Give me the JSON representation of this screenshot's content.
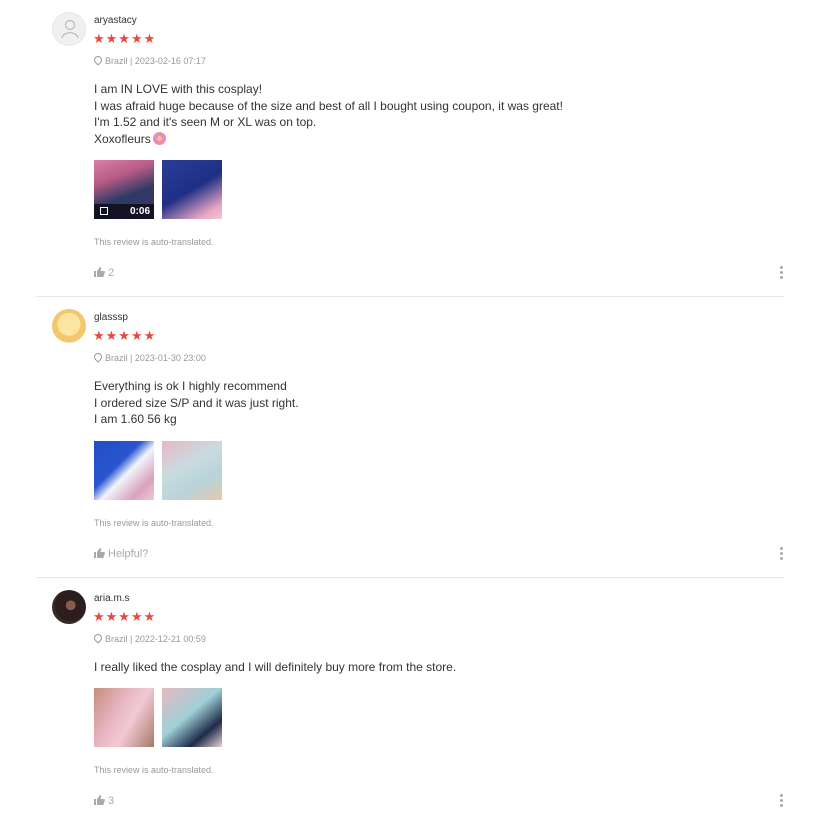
{
  "reviews": [
    {
      "username": "aryastacy",
      "stars": "★★★★★",
      "meta": "Brazil | 2023-02-16 07:17",
      "lines": [
        "I am IN LOVE with this cosplay!",
        "I was afraid huge because of the size and best of all I bought using coupon, it was great!",
        "I'm 1.52 and it's seen M or XL was on top.",
        "Xoxofleurs"
      ],
      "video_duration": "0:06",
      "auto_translated": "This review is auto-translated.",
      "helpful": "2"
    },
    {
      "username": "glasssp",
      "stars": "★★★★★",
      "meta": "Brazil | 2023-01-30 23:00",
      "lines": [
        "Everything is ok I highly recommend",
        "I ordered size S/P and it was just right.",
        "I am 1.60 56 kg"
      ],
      "auto_translated": "This review is auto-translated.",
      "helpful": "Helpful?"
    },
    {
      "username": "aria.m.s",
      "stars": "★★★★★",
      "meta": "Brazil | 2022-12-21 00:59",
      "lines": [
        "I really liked the cosplay and I will definitely buy more from the store."
      ],
      "auto_translated": "This review is auto-translated.",
      "helpful": "3"
    }
  ],
  "colors": {
    "star": "#e8493e",
    "muted": "#999999",
    "divider": "#e8e8e8"
  }
}
